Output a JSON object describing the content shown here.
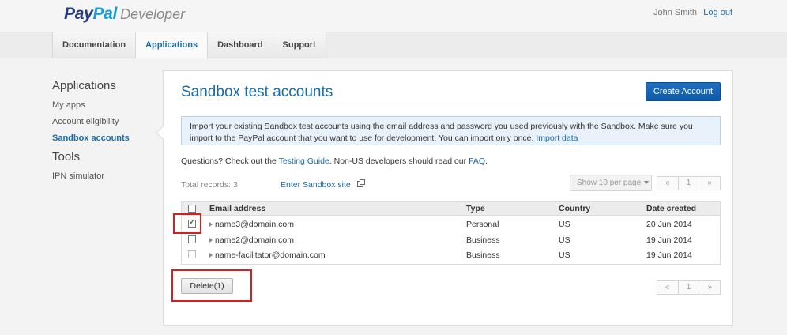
{
  "header": {
    "logo_pay": "Pay",
    "logo_pal": "Pal",
    "logo_dev": "Developer",
    "user_name": "John Smith",
    "logout": "Log out"
  },
  "nav": {
    "tabs": [
      {
        "label": "Documentation",
        "active": false
      },
      {
        "label": "Applications",
        "active": true
      },
      {
        "label": "Dashboard",
        "active": false
      },
      {
        "label": "Support",
        "active": false
      }
    ]
  },
  "sidebar": {
    "heading1": "Applications",
    "items1": [
      "My apps",
      "Account eligibility",
      "Sandbox accounts"
    ],
    "heading2": "Tools",
    "items2": [
      "IPN simulator"
    ]
  },
  "main": {
    "title": "Sandbox test accounts",
    "create_button": "Create Account",
    "info_text": "Import your existing Sandbox test accounts using the email address and password you used previously with the Sandbox. Make sure you import to the PayPal account that you want to use for development. You can import only once.",
    "info_link": "Import data",
    "questions_prefix": "Questions? Check out the",
    "testing_guide": "Testing Guide",
    "questions_mid": ". Non-US developers should read our",
    "faq": "FAQ",
    "questions_suffix": ".",
    "total_records": "Total records: 3",
    "enter_sandbox": "Enter Sandbox site",
    "per_page": "Show 10 per page",
    "pager": {
      "prev": "«",
      "page": "1",
      "next": "»"
    },
    "table": {
      "headers": [
        "Email address",
        "Type",
        "Country",
        "Date created"
      ],
      "rows": [
        {
          "email": "name3@domain.com",
          "type": "Personal",
          "country": "US",
          "date": "20 Jun 2014",
          "checked": true
        },
        {
          "email": "name2@domain.com",
          "type": "Business",
          "country": "US",
          "date": "19 Jun 2014",
          "checked": false
        },
        {
          "email": "name-facilitator@domain.com",
          "type": "Business",
          "country": "US",
          "date": "19 Jun 2014",
          "checked": false
        }
      ]
    },
    "delete_button": "Delete(1)"
  },
  "colors": {
    "link": "#1a6aa6",
    "primary_button": "#0d5aa8",
    "highlight": "#d62020",
    "info_bg": "#e9f2fb"
  }
}
